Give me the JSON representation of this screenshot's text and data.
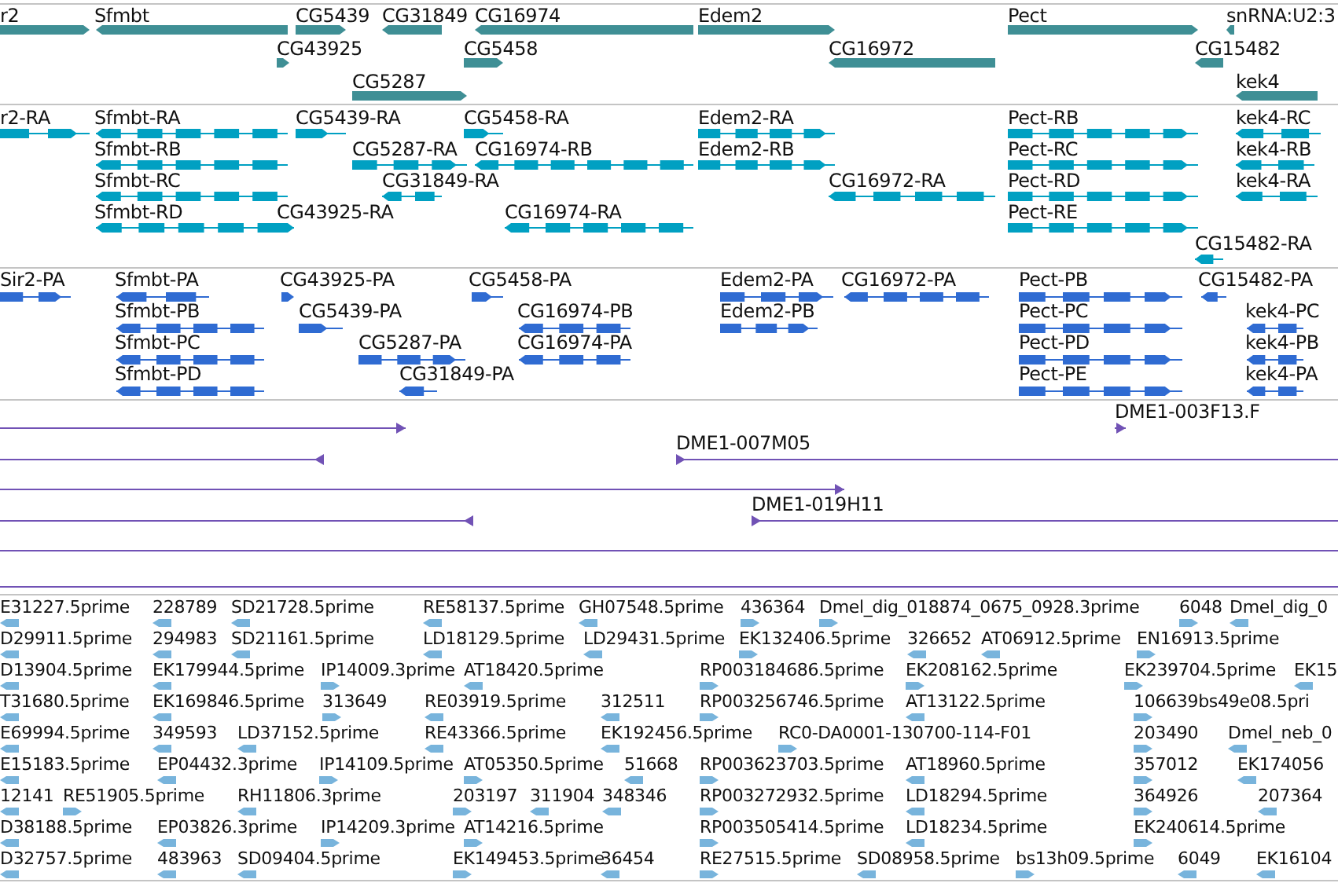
{
  "tracks": [
    {
      "kind": "gene",
      "features": [
        {
          "label": "r2",
          "reverse": false
        },
        {
          "label": "Sfmbt",
          "reverse": true
        },
        {
          "label": "CG5439",
          "reverse": false
        },
        {
          "label": "CG31849",
          "reverse": true
        },
        {
          "label": "CG16974",
          "reverse": true
        },
        {
          "label": "Edem2",
          "reverse": false
        },
        {
          "label": "Pect",
          "reverse": false
        },
        {
          "label": "snRNA:U2:3",
          "reverse": true
        },
        {
          "label": "CG43925",
          "reverse": false
        },
        {
          "label": "CG5458",
          "reverse": false
        },
        {
          "label": "CG16972",
          "reverse": true
        },
        {
          "label": "CG15482",
          "reverse": true
        },
        {
          "label": "CG5287",
          "reverse": false
        },
        {
          "label": "kek4",
          "reverse": true
        }
      ]
    },
    {
      "kind": "transcript",
      "features": [
        {
          "label": "r2-RA",
          "reverse": false
        },
        {
          "label": "Sfmbt-RA",
          "reverse": true
        },
        {
          "label": "CG5439-RA",
          "reverse": false
        },
        {
          "label": "CG5458-RA",
          "reverse": false
        },
        {
          "label": "Edem2-RA",
          "reverse": false
        },
        {
          "label": "Pect-RB",
          "reverse": false
        },
        {
          "label": "kek4-RC",
          "reverse": true
        },
        {
          "label": "Sfmbt-RB",
          "reverse": true
        },
        {
          "label": "CG5287-RA",
          "reverse": false
        },
        {
          "label": "CG16974-RB",
          "reverse": true
        },
        {
          "label": "Edem2-RB",
          "reverse": false
        },
        {
          "label": "Pect-RC",
          "reverse": false
        },
        {
          "label": "kek4-RB",
          "reverse": true
        },
        {
          "label": "Sfmbt-RC",
          "reverse": true
        },
        {
          "label": "CG31849-RA",
          "reverse": true
        },
        {
          "label": "CG16972-RA",
          "reverse": true
        },
        {
          "label": "Pect-RD",
          "reverse": false
        },
        {
          "label": "kek4-RA",
          "reverse": true
        },
        {
          "label": "Sfmbt-RD",
          "reverse": true
        },
        {
          "label": "CG43925-RA",
          "reverse": false
        },
        {
          "label": "CG16974-RA",
          "reverse": true
        },
        {
          "label": "Pect-RE",
          "reverse": false
        },
        {
          "label": "CG15482-RA",
          "reverse": true
        }
      ]
    },
    {
      "kind": "protein",
      "features": [
        {
          "label": "Sir2-PA",
          "reverse": false
        },
        {
          "label": "Sfmbt-PA",
          "reverse": true
        },
        {
          "label": "CG43925-PA",
          "reverse": false
        },
        {
          "label": "CG5458-PA",
          "reverse": false
        },
        {
          "label": "Edem2-PA",
          "reverse": false
        },
        {
          "label": "CG16972-PA",
          "reverse": true
        },
        {
          "label": "Pect-PB",
          "reverse": false
        },
        {
          "label": "CG15482-PA",
          "reverse": true
        },
        {
          "label": "Sfmbt-PB",
          "reverse": true
        },
        {
          "label": "CG5439-PA",
          "reverse": false
        },
        {
          "label": "CG16974-PB",
          "reverse": true
        },
        {
          "label": "Edem2-PB",
          "reverse": false
        },
        {
          "label": "Pect-PC",
          "reverse": false
        },
        {
          "label": "kek4-PC",
          "reverse": true
        },
        {
          "label": "Sfmbt-PC",
          "reverse": true
        },
        {
          "label": "CG5287-PA",
          "reverse": false
        },
        {
          "label": "CG16974-PA",
          "reverse": true
        },
        {
          "label": "Pect-PD",
          "reverse": false
        },
        {
          "label": "kek4-PB",
          "reverse": true
        },
        {
          "label": "Sfmbt-PD",
          "reverse": true
        },
        {
          "label": "CG31849-PA",
          "reverse": true
        },
        {
          "label": "Pect-PE",
          "reverse": false
        },
        {
          "label": "kek4-PA",
          "reverse": true
        }
      ]
    },
    {
      "kind": "clone",
      "features": [
        {
          "head": true,
          "reverse": false
        },
        {
          "label": "DME1-003F13.F",
          "head": true,
          "reverse": false
        },
        {
          "head": true,
          "reverse": true
        },
        {
          "label": "DME1-007M05",
          "head": true,
          "reverse": false
        },
        {
          "head": true,
          "reverse": false
        },
        {
          "head": true,
          "reverse": true
        },
        {
          "label": "DME1-019H11",
          "head": true,
          "reverse": false
        },
        {
          "head": false
        }
      ]
    },
    {
      "kind": "est",
      "features": [
        {
          "label": "E31227.5prime",
          "reverse": true
        },
        {
          "label": "228789",
          "reverse": true
        },
        {
          "label": "SD21728.5prime",
          "reverse": true
        },
        {
          "label": "RE58137.5prime",
          "reverse": true
        },
        {
          "label": "GH07548.5prime",
          "reverse": true
        },
        {
          "label": "436364",
          "reverse": false
        },
        {
          "label": "Dmel_dig_018874_0675_0928.3prime",
          "reverse": false
        },
        {
          "label": "6048",
          "reverse": false
        },
        {
          "label": "Dmel_dig_0",
          "reverse": true
        },
        {
          "label": "D29911.5prime",
          "reverse": true
        },
        {
          "label": "294983",
          "reverse": true
        },
        {
          "label": "SD21161.5prime",
          "reverse": true
        },
        {
          "label": "LD18129.5prime",
          "reverse": true
        },
        {
          "label": "LD29431.5prime",
          "reverse": true
        },
        {
          "label": "EK132406.5prime",
          "reverse": false
        },
        {
          "label": "326652",
          "reverse": true
        },
        {
          "label": "AT06912.5prime",
          "reverse": true
        },
        {
          "label": "EN16913.5prime",
          "reverse": false
        },
        {
          "label": "D13904.5prime",
          "reverse": true
        },
        {
          "label": "EK179944.5prime",
          "reverse": true
        },
        {
          "label": "IP14009.3prime",
          "reverse": false
        },
        {
          "label": "AT18420.5prime",
          "reverse": true
        },
        {
          "label": "RP003184686.5prime",
          "reverse": false
        },
        {
          "label": "EK208162.5prime",
          "reverse": false
        },
        {
          "label": "EK239704.5prime",
          "reverse": false
        },
        {
          "label": "EK15",
          "reverse": true
        },
        {
          "label": "T31680.5prime",
          "reverse": true
        },
        {
          "label": "EK169846.5prime",
          "reverse": true
        },
        {
          "label": "313649",
          "reverse": false
        },
        {
          "label": "RE03919.5prime",
          "reverse": true
        },
        {
          "label": "312511",
          "reverse": true
        },
        {
          "label": "RP003256746.5prime",
          "reverse": false
        },
        {
          "label": "AT13122.5prime",
          "reverse": true
        },
        {
          "label": "106639bs49e08.5pri",
          "reverse": false
        },
        {
          "label": "E69994.5prime",
          "reverse": true
        },
        {
          "label": "349593",
          "reverse": true
        },
        {
          "label": "LD37152.5prime",
          "reverse": true
        },
        {
          "label": "RE43366.5prime",
          "reverse": true
        },
        {
          "label": "EK192456.5prime",
          "reverse": true
        },
        {
          "label": "RC0-DA0001-130700-114-F01",
          "reverse": false
        },
        {
          "label": "203490",
          "reverse": false
        },
        {
          "label": "Dmel_neb_0",
          "reverse": true
        },
        {
          "label": "E15183.5prime",
          "reverse": true
        },
        {
          "label": "EP04432.3prime",
          "reverse": true
        },
        {
          "label": "IP14109.5prime",
          "reverse": false
        },
        {
          "label": "AT05350.5prime",
          "reverse": false
        },
        {
          "label": "51668",
          "reverse": true
        },
        {
          "label": "RP003623703.5prime",
          "reverse": false
        },
        {
          "label": "AT18960.5prime",
          "reverse": true
        },
        {
          "label": "357012",
          "reverse": false
        },
        {
          "label": "EK174056",
          "reverse": true
        },
        {
          "label": "12141",
          "reverse": true
        },
        {
          "label": "RE51905.5prime",
          "reverse": false
        },
        {
          "label": "RH11806.3prime",
          "reverse": true
        },
        {
          "label": "203197",
          "reverse": false
        },
        {
          "label": "311904",
          "reverse": true
        },
        {
          "label": "348346",
          "reverse": true
        },
        {
          "label": "RP003272932.5prime",
          "reverse": false
        },
        {
          "label": "LD18294.5prime",
          "reverse": true
        },
        {
          "label": "364926",
          "reverse": false
        },
        {
          "label": "207364",
          "reverse": true
        },
        {
          "label": "D38188.5prime",
          "reverse": true
        },
        {
          "label": "EP03826.3prime",
          "reverse": true
        },
        {
          "label": "IP14209.3prime",
          "reverse": false
        },
        {
          "label": "AT14216.5prime",
          "reverse": false
        },
        {
          "label": "RP003505414.5prime",
          "reverse": false
        },
        {
          "label": "LD18234.5prime",
          "reverse": true
        },
        {
          "label": "EK240614.5prime",
          "reverse": false
        },
        {
          "label": "D32757.5prime",
          "reverse": true
        },
        {
          "label": "483963",
          "reverse": true
        },
        {
          "label": "SD09404.5prime",
          "reverse": true
        },
        {
          "label": "EK149453.5prime",
          "reverse": false
        },
        {
          "label": "36454",
          "reverse": true
        },
        {
          "label": "RE27515.5prime",
          "reverse": false
        },
        {
          "label": "SD08958.5prime",
          "reverse": true
        },
        {
          "label": "bs13h09.5prime",
          "reverse": false
        },
        {
          "label": "6049",
          "reverse": true
        },
        {
          "label": "EK16104",
          "reverse": true
        }
      ]
    }
  ]
}
